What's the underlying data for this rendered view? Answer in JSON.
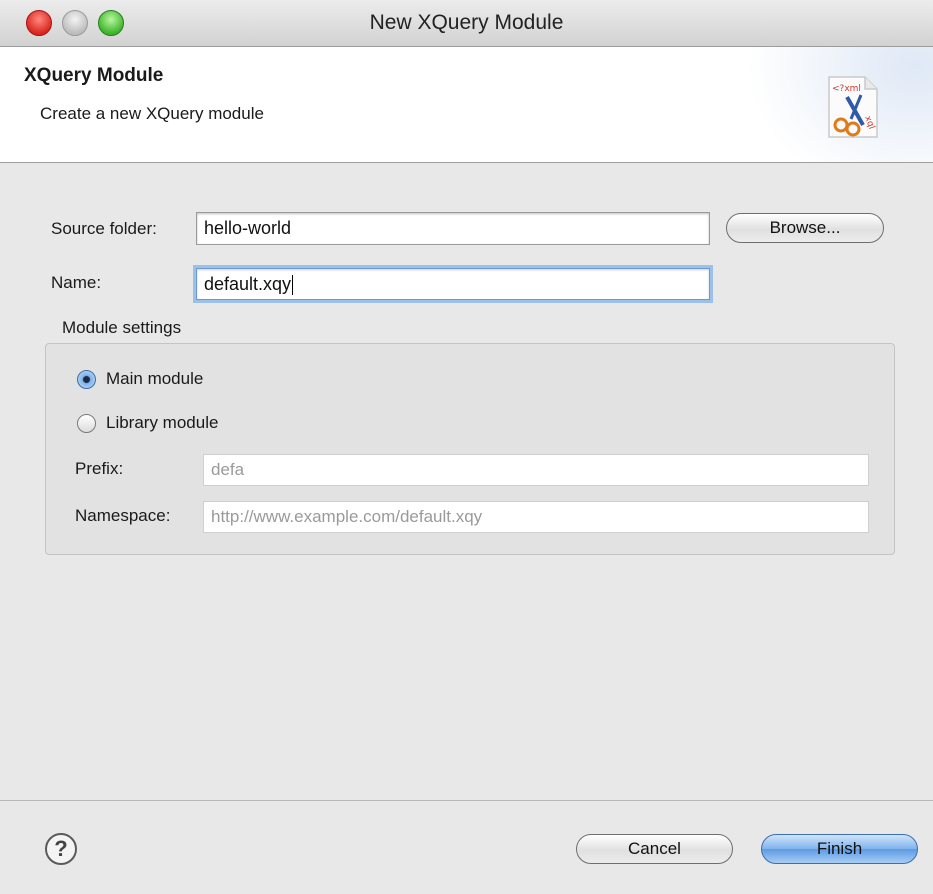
{
  "window": {
    "title": "New XQuery Module"
  },
  "header": {
    "title": "XQuery Module",
    "subtitle": "Create a new XQuery module",
    "icon_text_top": "<?xml",
    "icon_text_side": "xql"
  },
  "form": {
    "source_folder_label": "Source folder:",
    "source_folder_value": "hello-world",
    "browse_label": "Browse...",
    "name_label": "Name:",
    "name_value": "default.xqy"
  },
  "module_settings": {
    "group_label": "Module settings",
    "main_module_label": "Main module",
    "library_module_label": "Library module",
    "selected": "Main module",
    "prefix_label": "Prefix:",
    "prefix_value": "defa",
    "namespace_label": "Namespace:",
    "namespace_value": "http://www.example.com/default.xqy"
  },
  "footer": {
    "help_symbol": "?",
    "cancel_label": "Cancel",
    "finish_label": "Finish"
  },
  "colors": {
    "accent": "#5d9be4",
    "close": "#d9271f",
    "maximize": "#3fb52c"
  }
}
